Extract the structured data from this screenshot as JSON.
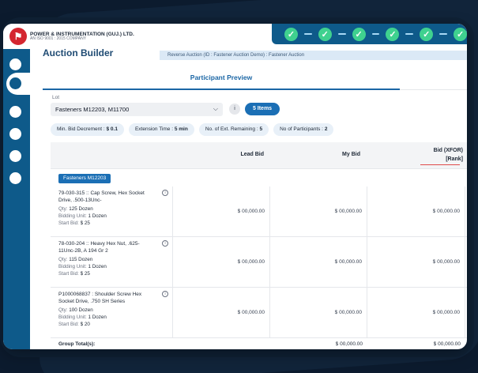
{
  "brand": {
    "name": "POWER & INSTRUMENTATION (GUJ.) LTD.",
    "tagline": "AN ISO 9001 : 2015 COMPANY",
    "accent": "#0e5a8a",
    "logo_color": "#d42630"
  },
  "steps": {
    "count": 6,
    "state": "completed",
    "icon": "check-icon",
    "color": "#3fd18f"
  },
  "page": {
    "title": "Auction Builder",
    "breadcrumb": "Reverse Auction (ID : Fastener Auction Demo) : Fastener Auction"
  },
  "tabs": [
    {
      "label": "Participant Preview",
      "active": true
    }
  ],
  "lot": {
    "label": "Lot",
    "selected": "Fasteners M12203, M11700",
    "info_label": "i",
    "items_badge": "5 Items"
  },
  "chips": [
    {
      "label": "Min. Bid Decrement : ",
      "value": "$ 0.1"
    },
    {
      "label": "Extension Time : ",
      "value": "5 min"
    },
    {
      "label": "No. of Ext. Remaining : ",
      "value": "5"
    },
    {
      "label": "No of Participants : ",
      "value": "2"
    }
  ],
  "table": {
    "columns": [
      "Lead Bid",
      "My Bid",
      "Bid (XFOR)",
      "[Rank]"
    ],
    "group": "Fasteners M12203",
    "rows": [
      {
        "title": "79-030-315 :: Cap Screw, Hex Socket Drive, .500-13Unc-",
        "qty": "125 Dozen",
        "unit": "1 Dozen",
        "start": "$ 25",
        "lead": "$ 00,000.00",
        "my": "$ 00,000.00",
        "bid": "$ 00,000.00"
      },
      {
        "title": "78-030-204 :: Heavy Hex Nut, .625-11Unc-2B, A 194 Gr 2",
        "qty": "115 Dozen",
        "unit": "1 Dozen",
        "start": "$ 25",
        "lead": "$ 00,000.00",
        "my": "$ 00,000.00",
        "bid": "$ 00,000.00"
      },
      {
        "title": "P1000068837 : Shoulder Screw Hex Socket Drive, .750 SH Series",
        "qty": "100 Dozen",
        "unit": "1 Dozen",
        "start": "$ 20",
        "lead": "$ 00,000.00",
        "my": "$ 00,000.00",
        "bid": "$ 00,000.00"
      }
    ],
    "labels": {
      "qty": "Qty: ",
      "unit": "Bidding Unit: ",
      "start": "Start Bid: "
    },
    "totals": {
      "label": "Group Total(s):",
      "my": "$ 00,000.00",
      "bid": "$ 00,000.00"
    }
  }
}
